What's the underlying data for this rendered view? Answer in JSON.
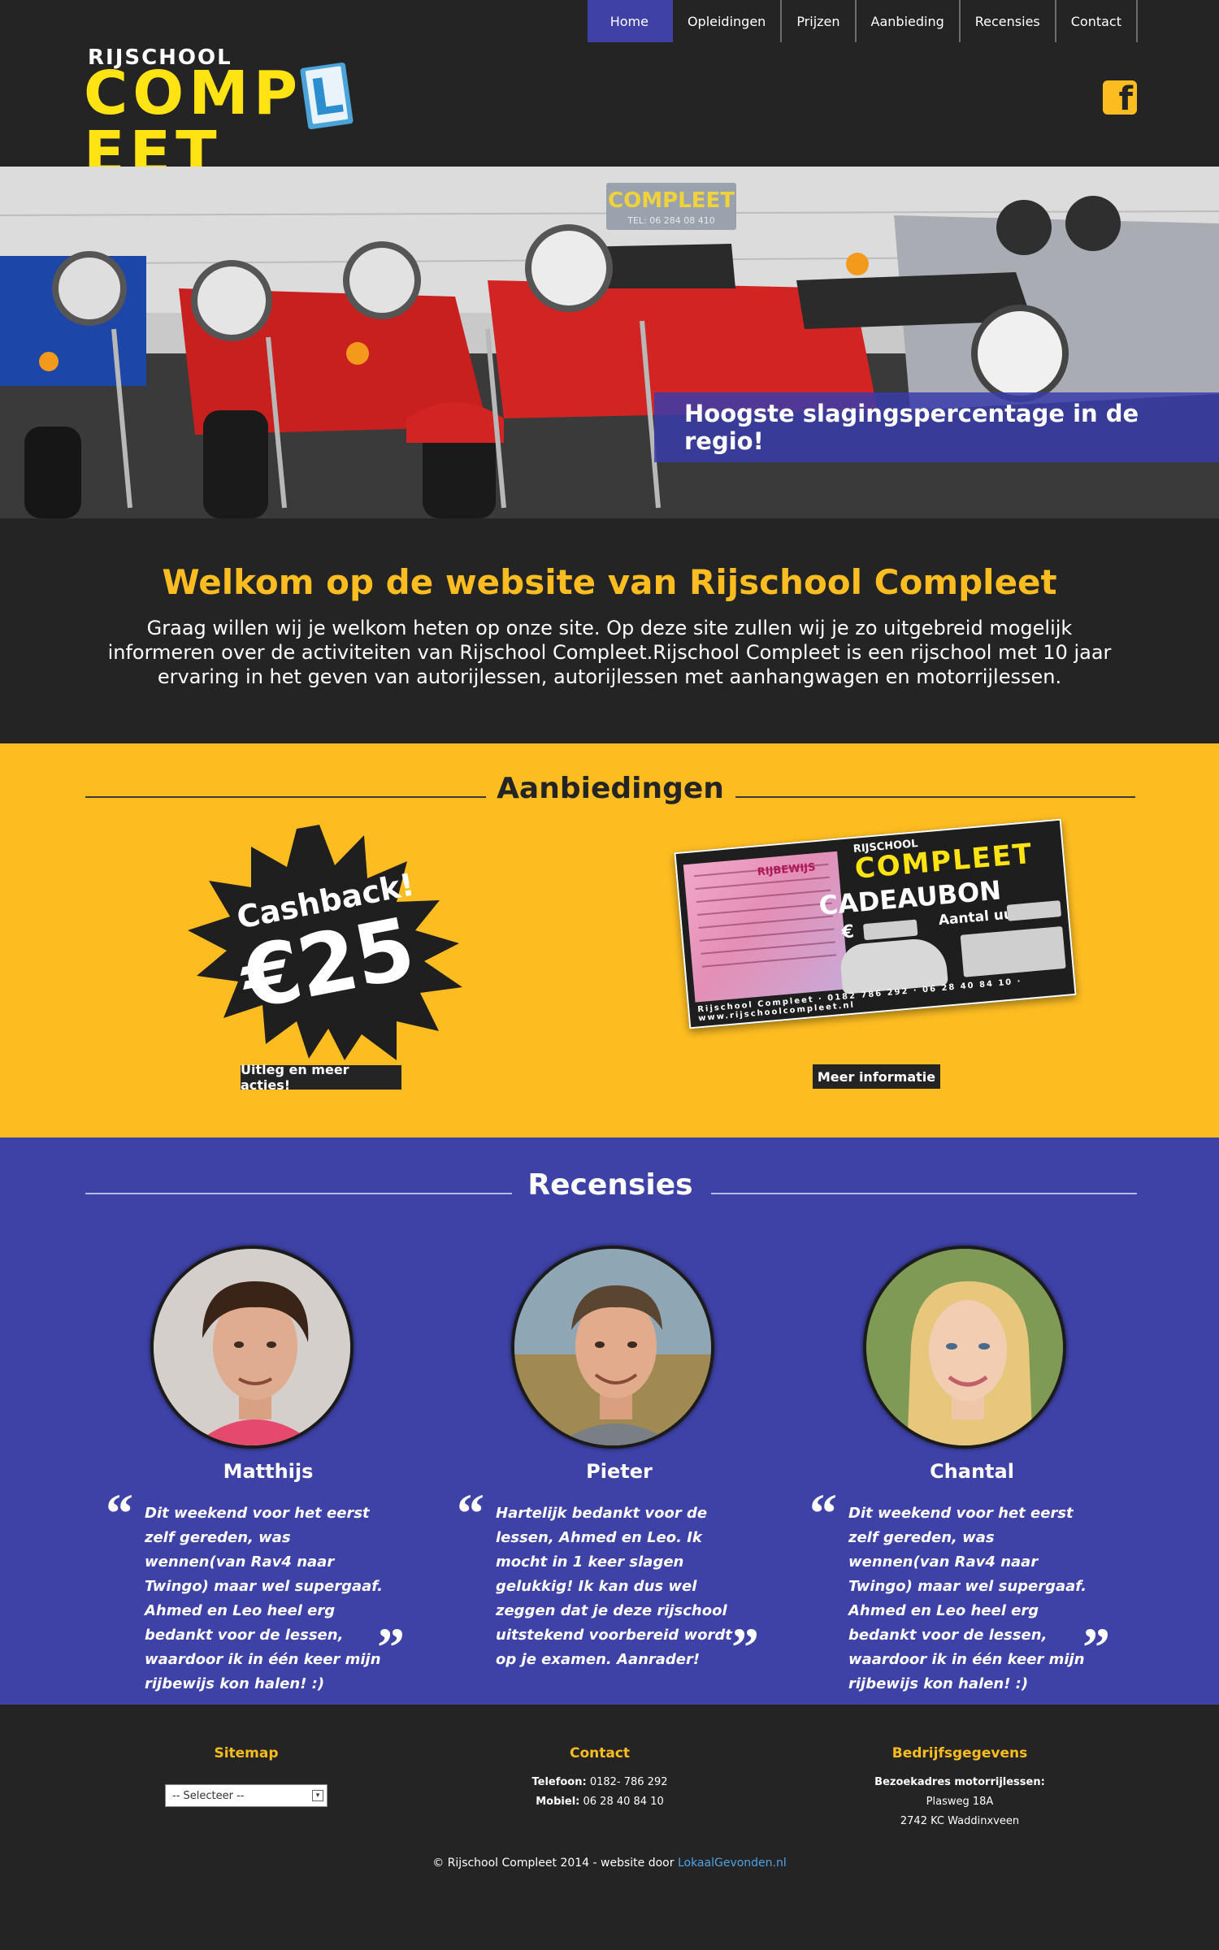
{
  "header": {
    "logo_top": "RIJSCHOOL",
    "logo_main_left": "COMP",
    "logo_main_l": "L",
    "logo_main_right": "EET"
  },
  "nav": {
    "items": [
      "Home",
      "Opleidingen",
      "Prijzen",
      "Aanbieding",
      "Recensies",
      "Contact"
    ],
    "active_index": 0
  },
  "hero": {
    "banner": "Hoogste slagingspercentage in de regio!",
    "sign_text": "COMPLEET",
    "sign_phone": "TEL: 06 284 08 410"
  },
  "welcome": {
    "title": "Welkom op de website van Rijschool Compleet",
    "text": "Graag willen wij je welkom heten op onze site. Op deze site zullen wij je zo uitgebreid mogelijk informeren over de activiteiten van Rijschool Compleet.Rijschool Compleet is een rijschool met 10 jaar ervaring in het geven van autorijlessen, autorijlessen met aanhangwagen en motorrijlessen."
  },
  "offers": {
    "title": "Aanbiedingen",
    "cashback_line1": "Cashback!",
    "cashback_line2": "€25",
    "cashback_button": "Uitleg en meer acties!",
    "voucher_button": "Meer informatie",
    "voucher": {
      "brand_small": "RIJSCHOOL",
      "brand": "COMPLEET",
      "title": "CADEAUBON",
      "euro": "€",
      "aantal": "Aantal uur",
      "license_label": "RIJBEWIJS",
      "footer": "Rijschool Compleet · 0182 786 292 · 06 28 40 84 10 · www.rijschoolcompleet.nl"
    }
  },
  "reviews": {
    "title": "Recensies",
    "items": [
      {
        "name": "Matthijs",
        "quote": "Dit weekend voor het eerst zelf gereden, was wennen(van Rav4 naar Twingo) maar wel supergaaf. Ahmed en Leo heel erg bedankt voor de lessen, waardoor ik in één keer mijn rijbewijs kon halen! :)"
      },
      {
        "name": "Pieter",
        "quote": "Hartelijk bedankt voor de lessen, Ahmed en Leo. Ik mocht in 1 keer slagen gelukkig! Ik kan dus wel zeggen dat je deze rijschool uitstekend voorbereid wordt op je examen. Aanrader!"
      },
      {
        "name": "Chantal",
        "quote": "Dit weekend voor het eerst zelf gereden, was wennen(van Rav4 naar Twingo) maar wel supergaaf. Ahmed en Leo heel erg bedankt voor de lessen, waardoor ik in één keer mijn rijbewijs kon halen! :)"
      }
    ],
    "open_quote": "“",
    "close_quote": "”"
  },
  "footer": {
    "sitemap_title": "Sitemap",
    "sitemap_select": "-- Selecteer --",
    "contact_title": "Contact",
    "phone_label": "Telefoon:",
    "phone": "0182- 786 292",
    "mobile_label": "Mobiel:",
    "mobile": "06 28 40 84 10",
    "company_title": "Bedrijfsgegevens",
    "address_label": "Bezoekadres motorrijlessen:",
    "street": "Plasweg 18A",
    "city": "2742 KC Waddinxveen",
    "copyright": "© Rijschool Compleet 2014 - website door",
    "credit_link": "LokaalGevonden.nl"
  },
  "colors": {
    "accent_yellow": "#fdbd21",
    "accent_blue": "#3e42a6",
    "dark": "#242424"
  },
  "icons": {
    "facebook": "facebook-icon",
    "select_arrow": "chevron-down-icon"
  }
}
